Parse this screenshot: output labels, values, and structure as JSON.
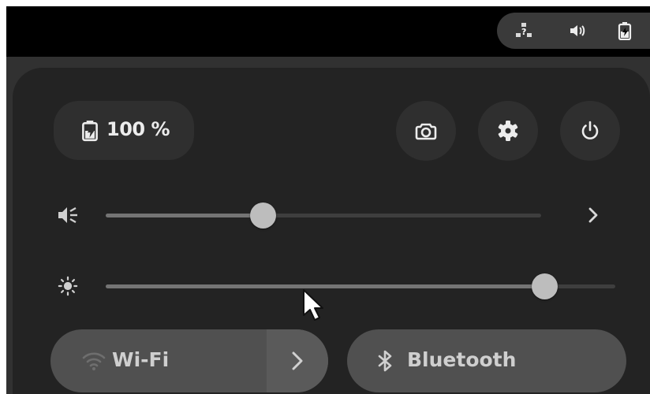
{
  "top_bar": {
    "status_icons": [
      "network-unknown-icon",
      "volume-icon",
      "battery-charging-icon"
    ]
  },
  "quick_settings": {
    "battery": {
      "icon": "battery-charging-icon",
      "label": "100 %"
    },
    "action_buttons": [
      {
        "name": "screenshot",
        "icon": "camera-icon"
      },
      {
        "name": "settings",
        "icon": "gear-icon"
      },
      {
        "name": "power",
        "icon": "power-icon"
      }
    ],
    "volume": {
      "icon": "volume-icon",
      "level": 0.36,
      "has_submenu": true
    },
    "brightness": {
      "icon": "brightness-icon",
      "level": 0.86
    },
    "toggles": {
      "wifi": {
        "label": "Wi-Fi",
        "icon": "wifi-icon",
        "active": false,
        "has_submenu": true
      },
      "bluetooth": {
        "label": "Bluetooth",
        "icon": "bluetooth-icon",
        "active": false
      }
    }
  },
  "colors": {
    "panel_background": "#232323",
    "button_background": "#2f2f2f",
    "toggle_inactive": "#505050",
    "slider_knob": "#bdbdbd",
    "text": "#ececec"
  }
}
